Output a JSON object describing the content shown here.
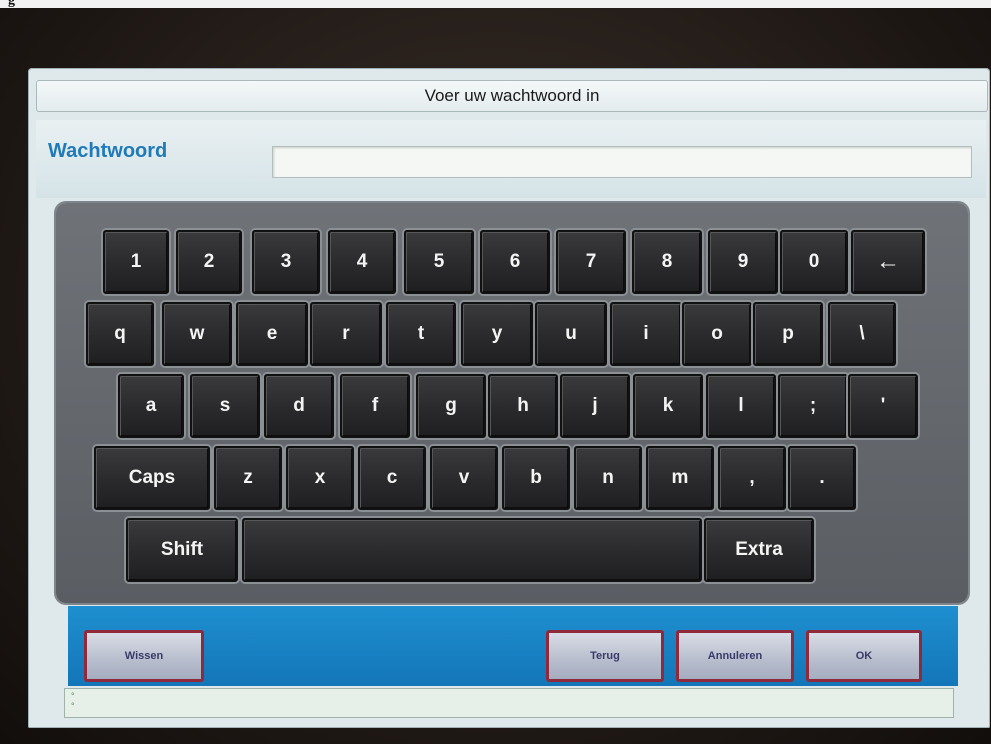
{
  "top_strip": {
    "text": "g"
  },
  "dialog": {
    "title": "Voer uw wachtwoord in",
    "field_label": "Wachtwoord",
    "field_value": ""
  },
  "keyboard": {
    "row1": [
      "1",
      "2",
      "3",
      "4",
      "5",
      "6",
      "7",
      "8",
      "9",
      "0",
      "←"
    ],
    "row2": [
      "q",
      "w",
      "e",
      "r",
      "t",
      "y",
      "u",
      "i",
      "o",
      "p",
      "\\"
    ],
    "row3": [
      "a",
      "s",
      "d",
      "f",
      "g",
      "h",
      "j",
      "k",
      "l",
      ";",
      "'"
    ],
    "row4": [
      "Caps",
      "z",
      "x",
      "c",
      "v",
      "b",
      "n",
      "m",
      ",",
      "."
    ],
    "row5": {
      "shift": "Shift",
      "space": "",
      "extra": "Extra"
    }
  },
  "buttons": {
    "wissen": "Wissen",
    "terug": "Terug",
    "annuleren": "Annuleren",
    "ok": "OK"
  },
  "status": {
    "dots": "°\n°"
  },
  "colors": {
    "accent_label": "#1f7ab8",
    "bottom_bar": "#1680c2",
    "key_face": "#2a2a2c",
    "button_border": "#8f2a3c"
  }
}
